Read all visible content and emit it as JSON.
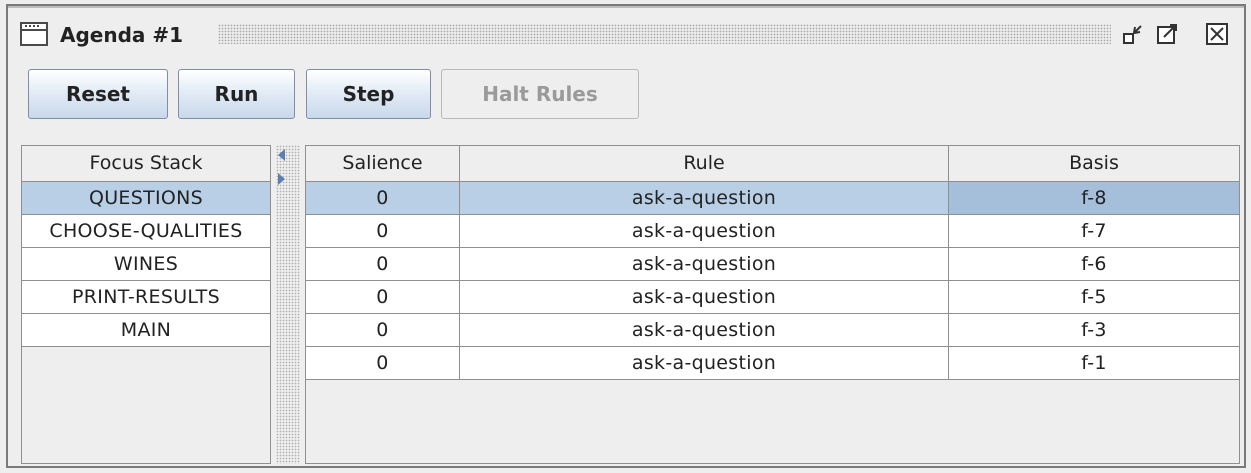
{
  "window": {
    "title": "Agenda #1",
    "controls": [
      "minimize-icon",
      "maximize-icon",
      "close-icon"
    ]
  },
  "toolbar": {
    "reset_label": "Reset",
    "run_label": "Run",
    "step_label": "Step",
    "halt_label": "Halt Rules"
  },
  "focus_stack": {
    "header": "Focus Stack",
    "items": [
      "QUESTIONS",
      "CHOOSE-QUALITIES",
      "WINES",
      "PRINT-RESULTS",
      "MAIN"
    ],
    "selected": "QUESTIONS"
  },
  "agenda": {
    "columns": [
      "Salience",
      "Rule",
      "Basis"
    ],
    "rows": [
      {
        "salience": "0",
        "rule": "ask-a-question",
        "basis": "f-8"
      },
      {
        "salience": "0",
        "rule": "ask-a-question",
        "basis": "f-7"
      },
      {
        "salience": "0",
        "rule": "ask-a-question",
        "basis": "f-6"
      },
      {
        "salience": "0",
        "rule": "ask-a-question",
        "basis": "f-5"
      },
      {
        "salience": "0",
        "rule": "ask-a-question",
        "basis": "f-3"
      },
      {
        "salience": "0",
        "rule": "ask-a-question",
        "basis": "f-1"
      }
    ]
  },
  "colors": {
    "selection": "#b8cfe5",
    "button_border": "#7d8ea6",
    "splitter_arrow": "#5d7fb0"
  }
}
